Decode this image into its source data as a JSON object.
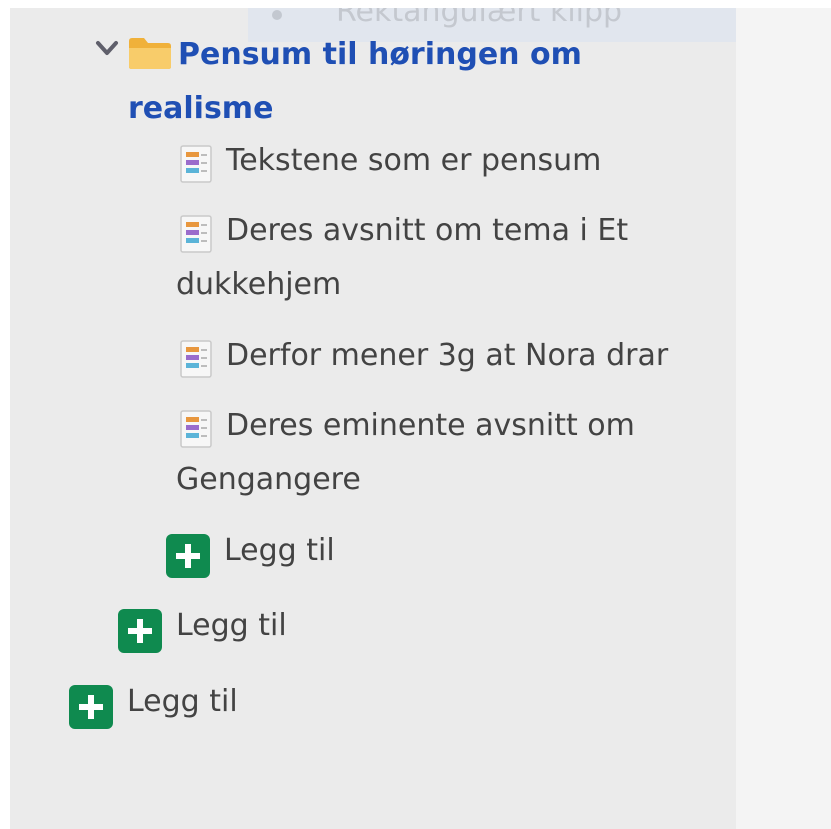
{
  "background_item": {
    "label": "Rektangulært klipp"
  },
  "folder": {
    "title": "Pensum til høringen om realisme",
    "icon": "folder-icon",
    "expand_icon": "chevron-down-icon",
    "accent": "#1f4fb4"
  },
  "items": [
    {
      "label": "Tekstene som er pensum",
      "icon": "document-icon"
    },
    {
      "label": "Deres avsnitt om tema i Et dukkehjem",
      "icon": "document-icon"
    },
    {
      "label": "Derfor mener 3g at Nora drar",
      "icon": "document-icon"
    },
    {
      "label": "Deres eminente avsnitt om Gengangere",
      "icon": "document-icon"
    }
  ],
  "add_buttons": [
    {
      "label": "Legg til",
      "icon": "plus-icon"
    },
    {
      "label": "Legg til",
      "icon": "plus-icon"
    },
    {
      "label": "Legg til",
      "icon": "plus-icon"
    }
  ],
  "colors": {
    "panel_bg": "#ebebeb",
    "text": "#434343",
    "add_button": "#0f8a4f",
    "folder_yellow": "#f6c35c"
  }
}
